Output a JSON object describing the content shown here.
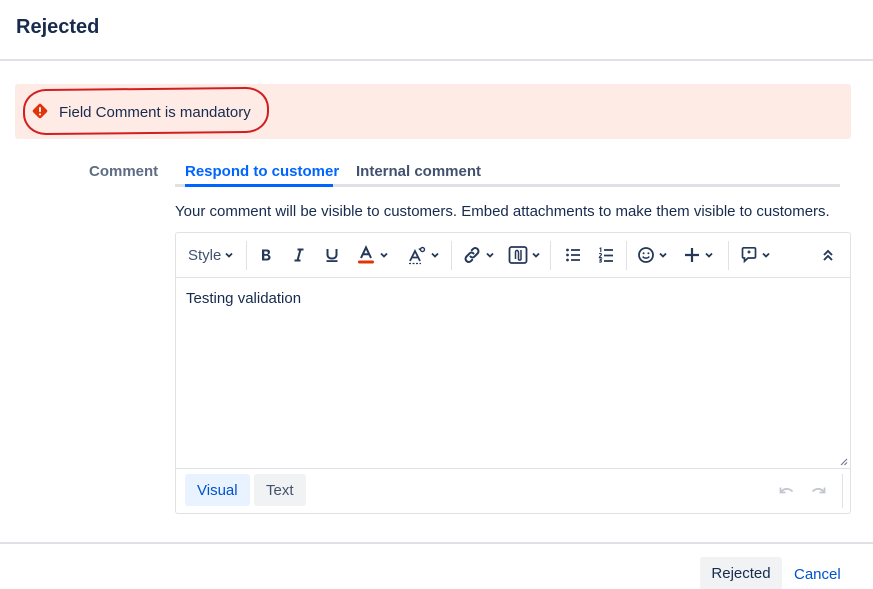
{
  "dialog": {
    "title": "Rejected"
  },
  "error": {
    "message": "Field Comment is mandatory",
    "color": "#ffebe6",
    "icon": "error-diamond-icon"
  },
  "comment_field": {
    "label": "Comment",
    "tabs": [
      {
        "label": "Respond to customer",
        "selected": true
      },
      {
        "label": "Internal comment",
        "selected": false
      }
    ],
    "visibility_note": "Your comment will be visible to customers. Embed attachments to make them visible to customers."
  },
  "toolbar": {
    "style_label": "Style",
    "items": [
      "bold-icon",
      "italic-icon",
      "underline-icon",
      "text-color-icon",
      "text-effects-icon",
      "link-icon",
      "attachment-icon",
      "bullet-list-icon",
      "numbered-list-icon",
      "emoji-icon",
      "insert-plus-icon",
      "feedback-icon",
      "collapse-toolbar-icon"
    ],
    "text_color_accent": "#de350b"
  },
  "editor": {
    "value": "Testing validation"
  },
  "editor_modes": {
    "visual": "Visual",
    "text": "Text",
    "selected": "Visual"
  },
  "actions": {
    "submit": "Rejected",
    "cancel": "Cancel"
  },
  "colors": {
    "accent": "#0065ff",
    "error_ring": "#d11f1f"
  }
}
